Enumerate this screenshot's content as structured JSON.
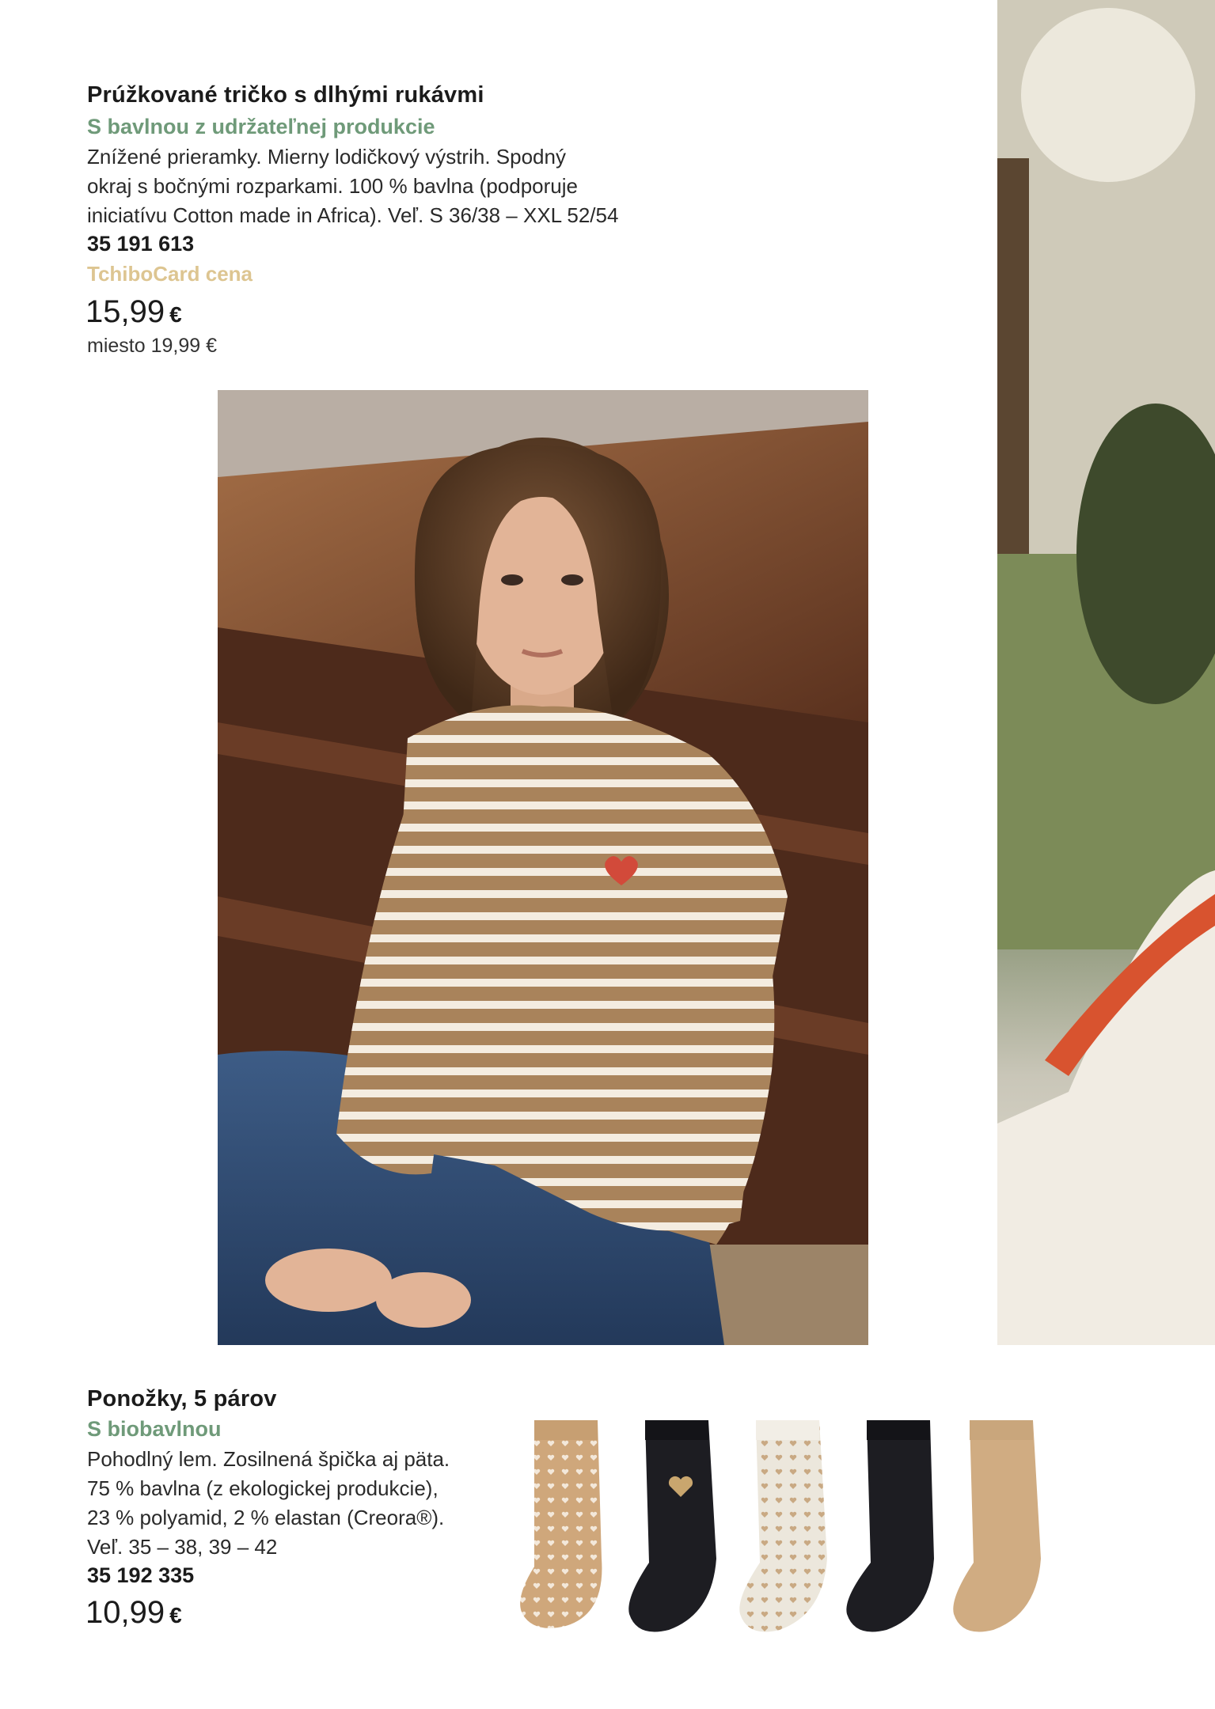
{
  "product1": {
    "title": "Prúžkované tričko s dlhými rukávmi",
    "subtitle": "S bavlnou z udržateľnej produkcie",
    "description": [
      "Znížené prieramky. Mierny lodičkový výstrih. Spodný",
      "okraj s bočnými rozparkami. 100 % bavlna (podporuje",
      "iniciatívu Cotton made in Africa). Veľ. S 36/38 – XXL 52/54"
    ],
    "article_number": "35 191 613",
    "card_label": "TchiboCard cena",
    "price": "15,99",
    "currency": "€",
    "old_price": "miesto 19,99 €"
  },
  "product2": {
    "title": "Ponožky, 5 párov",
    "subtitle": "S biobavlnou",
    "description": [
      "Pohodlný lem. Zosilnená špička aj päta.",
      "75 % bavlna (z ekologickej produkcie),",
      "23 % polyamid, 2 % elastan (Creora®).",
      "Veľ. 35 – 38, 39 – 42"
    ],
    "article_number": "35 192 335",
    "price": "10,99",
    "currency": "€"
  },
  "colors": {
    "accent_green": "#6f9a79",
    "card_gold": "#ddc591",
    "stripe_brown": "#a9835b",
    "stripe_cream": "#f4ece0"
  },
  "socks": [
    "beige-hearts-sock",
    "black-gold-heart-sock",
    "cream-hearts-sock",
    "black-sock",
    "beige-sock"
  ]
}
